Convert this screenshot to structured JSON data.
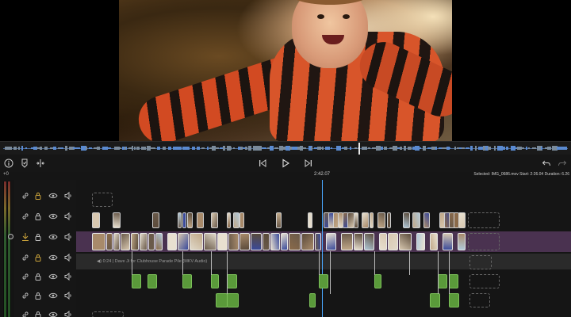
{
  "viewer": {
    "description_icon": "video-frame"
  },
  "transport": {
    "info_icon": "info-icon",
    "marker_icon": "marker-icon",
    "split_icon": "split-icon",
    "prev_icon": "skip-back-icon",
    "play_icon": "play-icon",
    "next_icon": "skip-forward-icon",
    "undo_icon": "undo-icon",
    "redo_icon": "redo-icon"
  },
  "ruler": {
    "zero_label": "+0",
    "timecode": "2:42.07",
    "selected_info": "Selected: IMG_0686.mov Start: 2:26.04 Duration: 6.26"
  },
  "timeline": {
    "audio_clip_label": "◀) 0:24 | Dave Ji for Clubhouse Parade Pile (MKV Audio)",
    "tracks": [
      {
        "name": "track-1",
        "locked": true
      },
      {
        "name": "track-2",
        "locked": false
      },
      {
        "name": "track-main",
        "locked": false
      },
      {
        "name": "track-audio",
        "locked": true
      },
      {
        "name": "track-5",
        "locked": false
      },
      {
        "name": "track-6",
        "locked": false
      },
      {
        "name": "track-7",
        "locked": false
      }
    ]
  },
  "colors": {
    "playhead": "#4aa8ff",
    "main_lane": "#4a3250",
    "audio_clip": "#5a9a3a"
  }
}
